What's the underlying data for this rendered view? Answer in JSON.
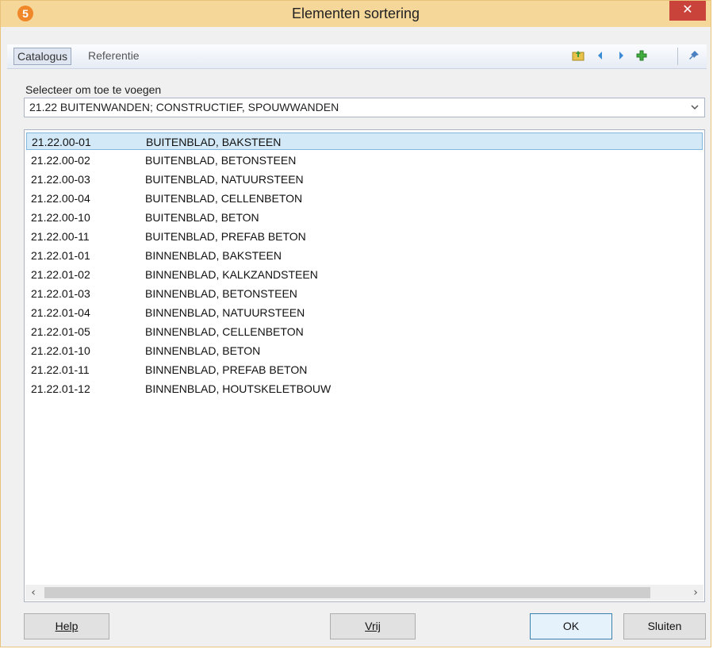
{
  "window": {
    "app_badge": "5",
    "title": "Elementen sortering",
    "close_glyph": "✕"
  },
  "toolbar": {
    "tabs": [
      "Catalogus",
      "Referentie"
    ],
    "icons": [
      "folder-up-icon",
      "arrow-left-icon",
      "arrow-right-icon",
      "add-icon",
      "pin-icon"
    ]
  },
  "selector": {
    "label": "Selecteer om toe te voegen",
    "value": "21.22  BUITENWANDEN; CONSTRUCTIEF, SPOUWWANDEN"
  },
  "list": {
    "selected_index": 0,
    "rows": [
      {
        "code": "21.22.00-01",
        "desc": "BUITENBLAD, BAKSTEEN"
      },
      {
        "code": "21.22.00-02",
        "desc": "BUITENBLAD, BETONSTEEN"
      },
      {
        "code": "21.22.00-03",
        "desc": "BUITENBLAD, NATUURSTEEN"
      },
      {
        "code": "21.22.00-04",
        "desc": "BUITENBLAD, CELLENBETON"
      },
      {
        "code": "21.22.00-10",
        "desc": "BUITENBLAD, BETON"
      },
      {
        "code": "21.22.00-11",
        "desc": "BUITENBLAD, PREFAB BETON"
      },
      {
        "code": "21.22.01-01",
        "desc": "BINNENBLAD, BAKSTEEN"
      },
      {
        "code": "21.22.01-02",
        "desc": "BINNENBLAD, KALKZANDSTEEN"
      },
      {
        "code": "21.22.01-03",
        "desc": "BINNENBLAD, BETONSTEEN"
      },
      {
        "code": "21.22.01-04",
        "desc": "BINNENBLAD, NATUURSTEEN"
      },
      {
        "code": "21.22.01-05",
        "desc": "BINNENBLAD, CELLENBETON"
      },
      {
        "code": "21.22.01-10",
        "desc": "BINNENBLAD, BETON"
      },
      {
        "code": "21.22.01-11",
        "desc": "BINNENBLAD, PREFAB BETON"
      },
      {
        "code": "21.22.01-12",
        "desc": "BINNENBLAD, HOUTSKELETBOUW"
      }
    ]
  },
  "buttons": {
    "help": "Help",
    "vrij": "Vrij",
    "ok": "OK",
    "sluiten": "Sluiten"
  }
}
